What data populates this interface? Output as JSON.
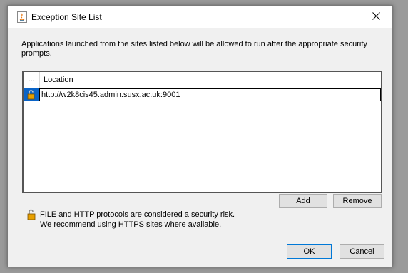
{
  "window": {
    "title": "Exception Site List",
    "icons": {
      "app": "java-icon",
      "close": "close-icon"
    }
  },
  "message": "Applications launched from the sites listed below will be allowed to run after the appropriate security prompts.",
  "table": {
    "columns": [
      "...",
      "Location"
    ],
    "rows": [
      {
        "icon": "unlocked-padlock-icon",
        "location": "http://w2k8cis45.admin.susx.ac.uk:9001"
      }
    ],
    "selected_row_color": "#0a64c8"
  },
  "buttons": {
    "add": "Add",
    "remove": "Remove",
    "ok": "OK",
    "cancel": "Cancel"
  },
  "warning": {
    "icon": "unlocked-padlock-icon",
    "line1": "FILE and HTTP protocols are considered a security risk.",
    "line2": "We recommend using HTTPS sites where available."
  }
}
